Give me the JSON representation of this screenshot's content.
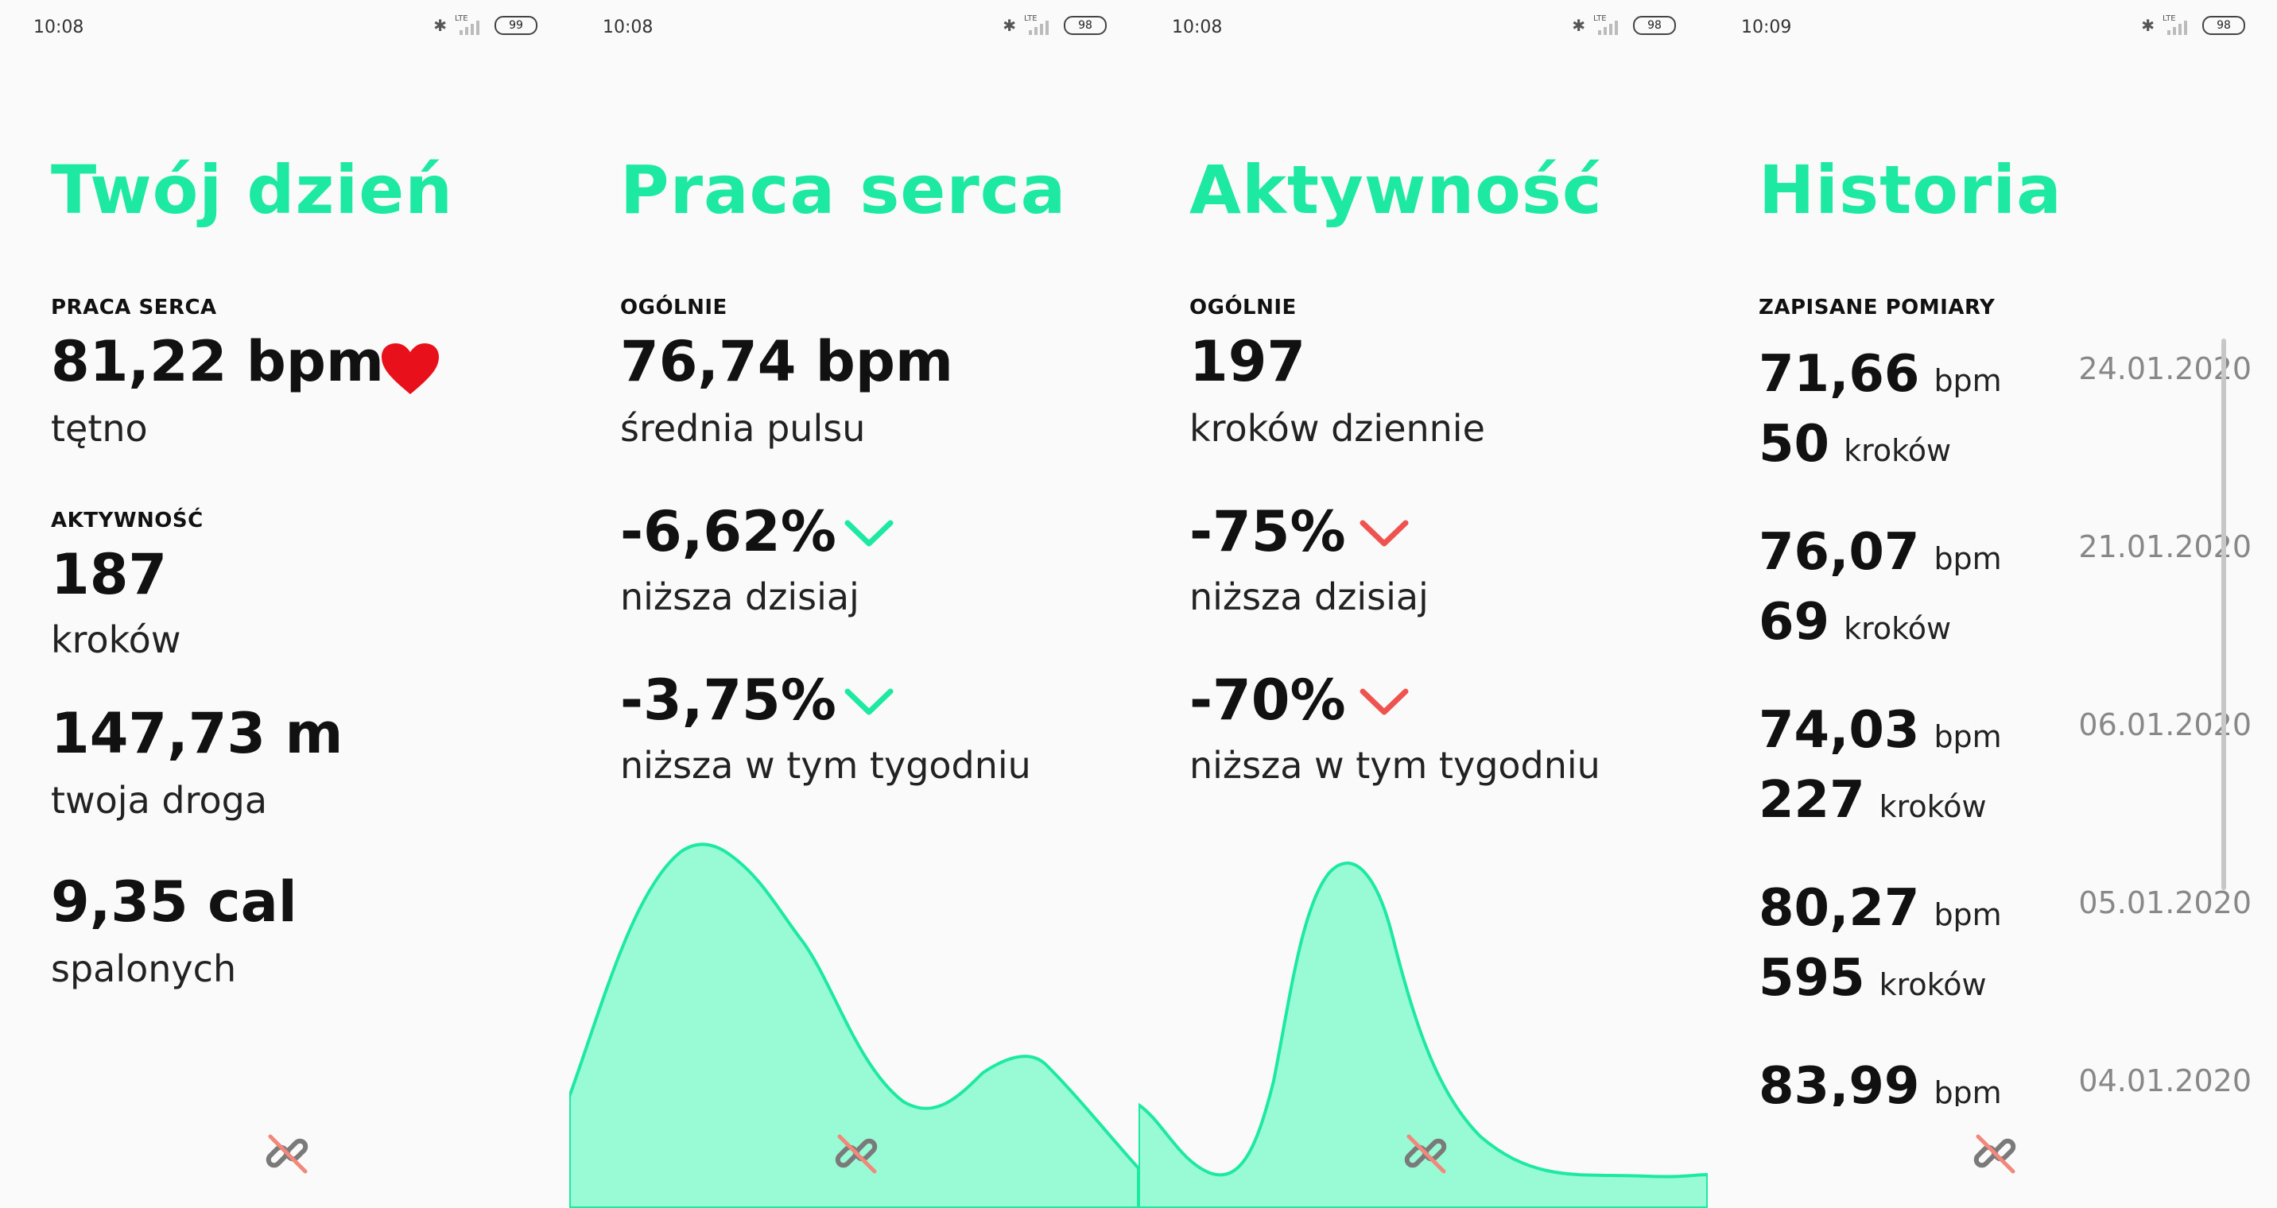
{
  "colors": {
    "accent": "#1de9a2",
    "chart_fill": "#99fbd5",
    "negative": "#ef5350",
    "heart": "#e8101a",
    "date": "#888888"
  },
  "screens": [
    {
      "status": {
        "time": "10:08",
        "network": "LTE",
        "battery": "99"
      },
      "title": "Twój dzień",
      "sections": [
        {
          "label": "PRACA SERCA",
          "value": "81,22 bpm",
          "caption": "tętno",
          "icon": "heart-icon"
        },
        {
          "label": "AKTYWNOŚĆ",
          "value": "187",
          "caption": "kroków"
        },
        {
          "value": "147,73 m",
          "caption": "twoja droga"
        },
        {
          "value": "9,35 cal",
          "caption": "spalonych"
        }
      ],
      "footer_icon": "broken-link-icon"
    },
    {
      "status": {
        "time": "10:08",
        "network": "LTE",
        "battery": "98"
      },
      "title": "Praca serca",
      "label": "OGÓLNIE",
      "value": "76,74 bpm",
      "caption": "średnia pulsu",
      "changes": [
        {
          "value": "-6,62%",
          "caption": "niższa dzisiaj",
          "icon": "chevron-down-icon",
          "color": "#1de9a2"
        },
        {
          "value": "-3,75%",
          "caption": "niższa w tym tygodniu",
          "icon": "chevron-down-icon",
          "color": "#1de9a2"
        }
      ],
      "footer_icon": "broken-link-icon"
    },
    {
      "status": {
        "time": "10:08",
        "network": "LTE",
        "battery": "98"
      },
      "title": "Aktywność",
      "label": "OGÓLNIE",
      "value": "197",
      "caption": "kroków dziennie",
      "changes": [
        {
          "value": "-75%",
          "caption": "niższa dzisiaj",
          "icon": "chevron-down-icon",
          "color": "#ef5350"
        },
        {
          "value": "-70%",
          "caption": "niższa w tym tygodniu",
          "icon": "chevron-down-icon",
          "color": "#ef5350"
        }
      ],
      "footer_icon": "broken-link-icon"
    },
    {
      "status": {
        "time": "10:09",
        "network": "LTE",
        "battery": "98"
      },
      "title": "Historia",
      "label": "ZAPISANE POMIARY",
      "entries": [
        {
          "bpm": "71,66",
          "bpm_unit": "bpm",
          "steps": "50",
          "steps_unit": "kroków",
          "date": "24.01.2020"
        },
        {
          "bpm": "76,07",
          "bpm_unit": "bpm",
          "steps": "69",
          "steps_unit": "kroków",
          "date": "21.01.2020"
        },
        {
          "bpm": "74,03",
          "bpm_unit": "bpm",
          "steps": "227",
          "steps_unit": "kroków",
          "date": "06.01.2020"
        },
        {
          "bpm": "80,27",
          "bpm_unit": "bpm",
          "steps": "595",
          "steps_unit": "kroków",
          "date": "05.01.2020"
        },
        {
          "bpm": "83,99",
          "bpm_unit": "bpm",
          "date": "04.01.2020"
        }
      ],
      "footer_icon": "broken-link-icon"
    }
  ]
}
